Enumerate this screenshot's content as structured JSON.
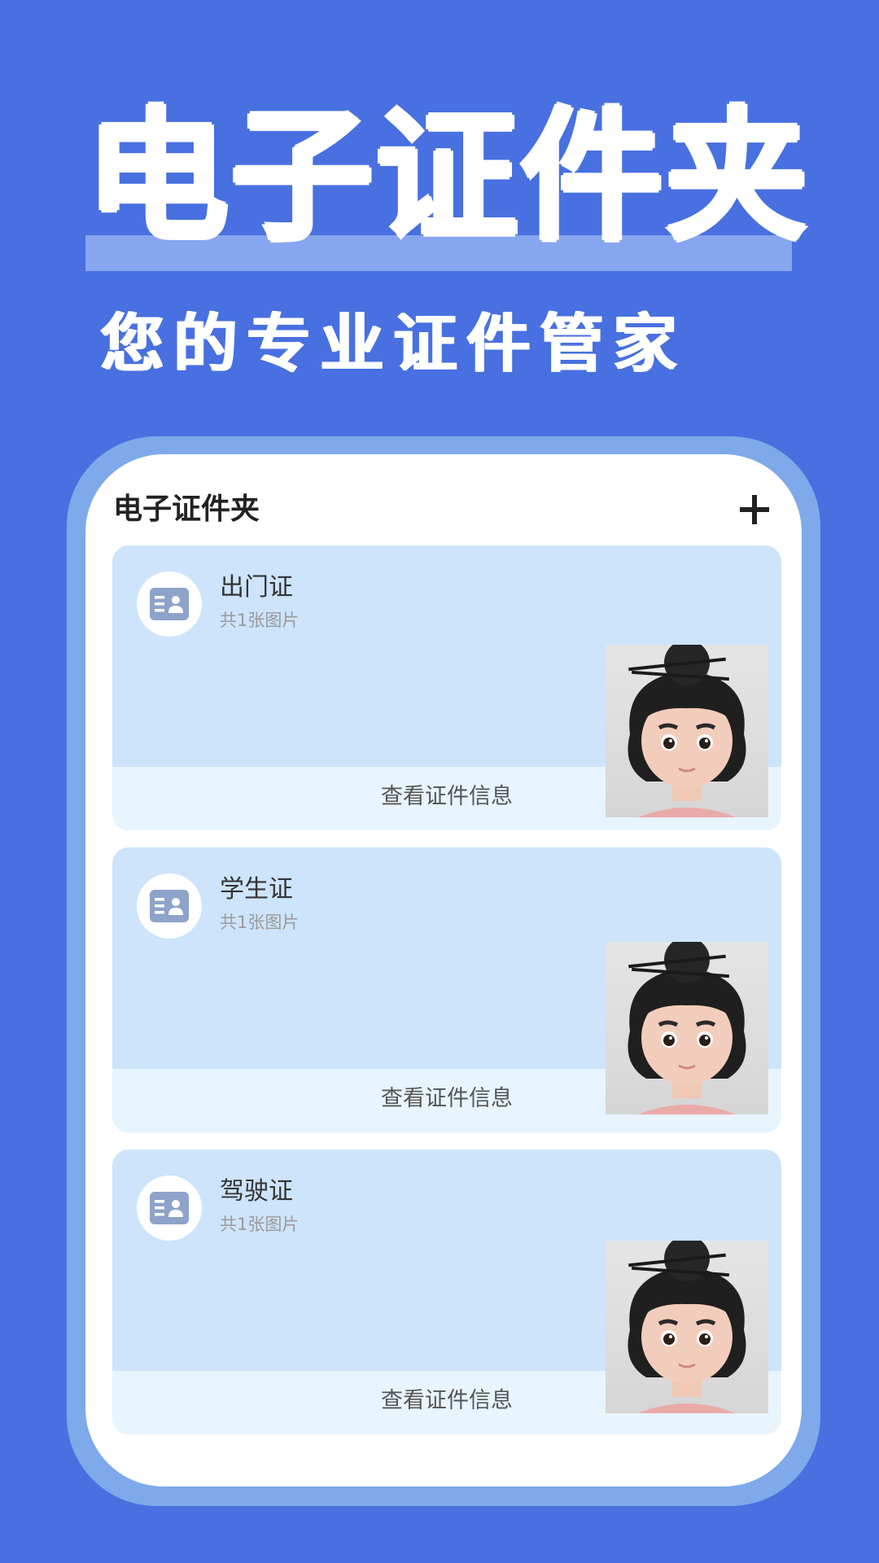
{
  "hero": {
    "title": "电子证件夹",
    "subtitle": "您的专业证件管家"
  },
  "app": {
    "header_title": "电子证件夹",
    "add_icon": "plus-icon",
    "cards": [
      {
        "title": "出门证",
        "subtitle": "共1张图片",
        "action_label": "查看证件信息",
        "icon": "id-card-icon"
      },
      {
        "title": "学生证",
        "subtitle": "共1张图片",
        "action_label": "查看证件信息",
        "icon": "id-card-icon"
      },
      {
        "title": "驾驶证",
        "subtitle": "共1张图片",
        "action_label": "查看证件信息",
        "icon": "id-card-icon"
      }
    ]
  },
  "colors": {
    "background": "#4870e0",
    "frame": "#7ea9ea",
    "card": "#cde4fb",
    "card_footer": "#e8f4fe",
    "icon_accent": "#8ea3c9"
  }
}
